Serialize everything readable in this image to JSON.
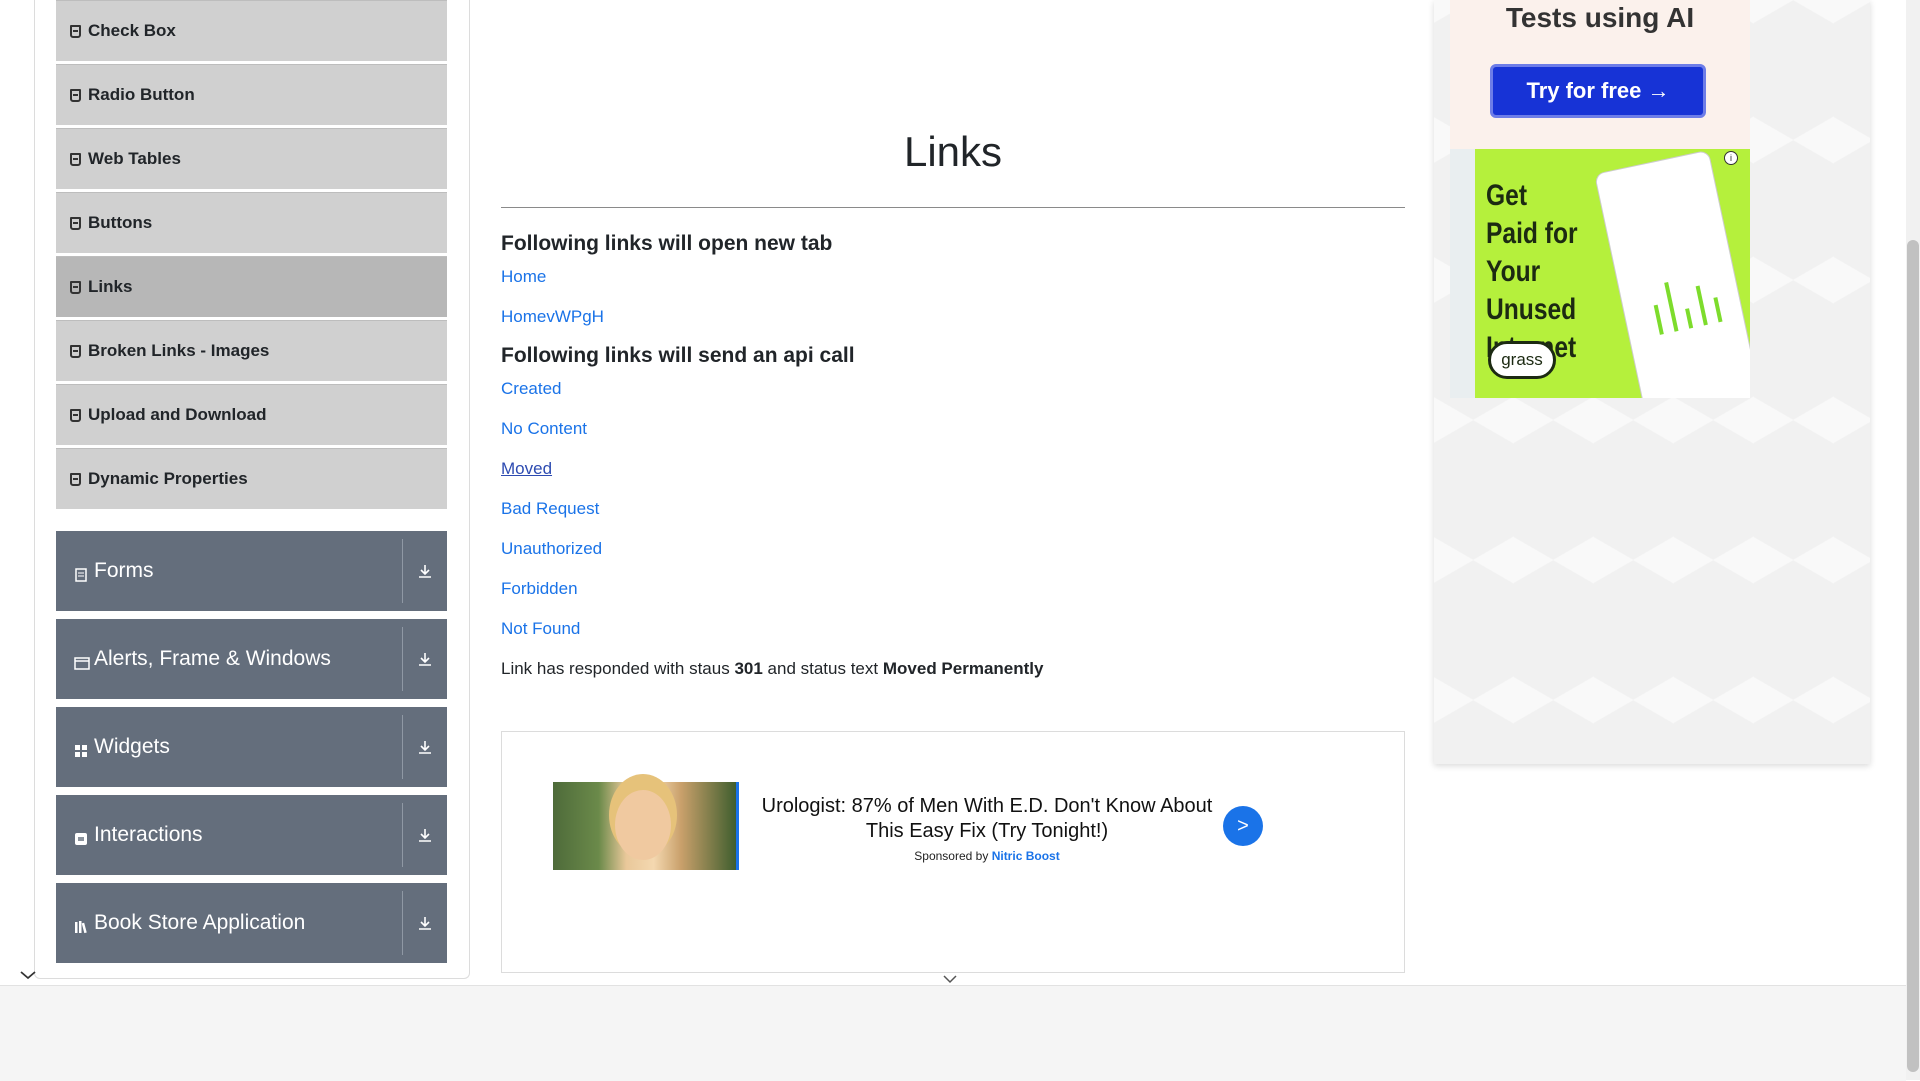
{
  "sidebar": {
    "element_items": [
      {
        "label": "Check Box",
        "active": false
      },
      {
        "label": "Radio Button",
        "active": false
      },
      {
        "label": "Web Tables",
        "active": false
      },
      {
        "label": "Buttons",
        "active": false
      },
      {
        "label": "Links",
        "active": true
      },
      {
        "label": "Broken Links - Images",
        "active": false
      },
      {
        "label": "Upload and Download",
        "active": false
      },
      {
        "label": "Dynamic Properties",
        "active": false
      }
    ],
    "groups": [
      {
        "label": "Forms",
        "icon": "form-icon"
      },
      {
        "label": "Alerts, Frame & Windows",
        "icon": "window-icon"
      },
      {
        "label": "Widgets",
        "icon": "widgets-icon"
      },
      {
        "label": "Interactions",
        "icon": "interactions-icon"
      },
      {
        "label": "Book Store Application",
        "icon": "books-icon"
      }
    ]
  },
  "main": {
    "title": "Links",
    "new_tab_heading": "Following links will open new tab",
    "new_tab_links": [
      "Home",
      "HomevWPgH"
    ],
    "api_heading": "Following links will send an api call",
    "api_links": [
      "Created",
      "No Content",
      "Moved",
      "Bad Request",
      "Unauthorized",
      "Forbidden",
      "Not Found"
    ],
    "visited_link": "Moved",
    "response": {
      "prefix": "Link has responded with staus",
      "status": "301",
      "middle": "and status text",
      "status_text": "Moved Permanently"
    }
  },
  "sponsored": {
    "headline": "Urologist: 87% of Men With E.D. Don't Know About This Easy Fix (Try Tonight!)",
    "sponsored_by": "Sponsored by",
    "brand": "Nitric Boost",
    "go_label": ">"
  },
  "right_ads": {
    "ai_text": "Tests using AI",
    "try_label": "Try for free →",
    "grass_text": "Get Paid for Your Unused Internet",
    "grass_logo": "grass"
  },
  "colors": {
    "link": "#1a73e8",
    "group_bg": "#646e7c",
    "sub_item_bg": "#d0d0d0",
    "sub_item_active_bg": "#b7b7b7",
    "try_button": "#1733d6",
    "grass_green": "#b5f03c"
  }
}
